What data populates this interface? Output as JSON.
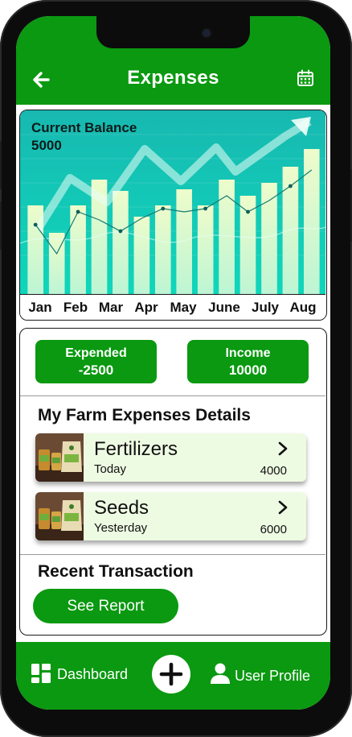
{
  "header": {
    "title": "Expenses",
    "back_icon": "arrow-left-icon",
    "calendar_icon": "calendar-icon"
  },
  "balance": {
    "label": "Current Balance",
    "value": "5000"
  },
  "chart_data": {
    "type": "bar",
    "categories": [
      "Jan",
      "Feb",
      "Mar",
      "Apr",
      "May",
      "June",
      "July",
      "Aug"
    ],
    "series": [
      {
        "values": [
          55,
          38,
          55,
          71,
          64,
          48,
          55,
          65,
          55,
          71,
          61,
          69,
          79,
          90
        ]
      }
    ],
    "line_values": [
      52,
      34,
      60,
      55,
      48,
      56,
      62,
      60,
      62,
      70,
      60,
      67,
      76,
      86
    ],
    "trend_arrow": "up",
    "colors": {
      "background": "#13c7b6",
      "bar": "#e2fbc4",
      "arrow": "#e9fff6"
    }
  },
  "summary": {
    "expended_label": "Expended",
    "expended_value": "-2500",
    "income_label": "Income",
    "income_value": "10000"
  },
  "details": {
    "title": "My Farm Expenses Details",
    "items": [
      {
        "name": "Fertilizers",
        "when": "Today",
        "amount": "4000"
      },
      {
        "name": "Seeds",
        "when": "Yesterday",
        "amount": "6000"
      }
    ]
  },
  "recent": {
    "title": "Recent Transaction",
    "button": "See Report"
  },
  "nav": {
    "dashboard": "Dashboard",
    "profile": "User Profile",
    "add_icon": "plus-icon"
  },
  "colors": {
    "primary": "#0a9910",
    "item_bg": "#eefbe3"
  }
}
